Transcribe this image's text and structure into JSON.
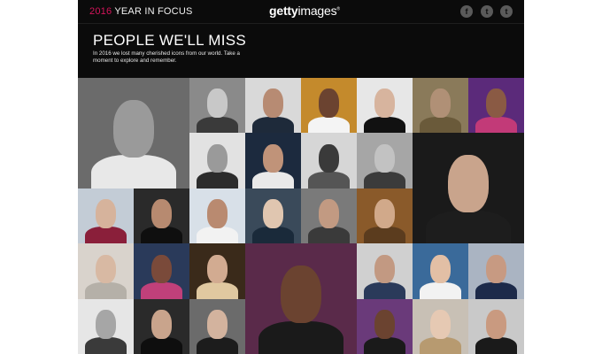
{
  "header": {
    "year": "2016",
    "title_rest": " YEAR IN FOCUS",
    "logo_bold": "getty",
    "logo_rest": "images",
    "logo_mark": "®"
  },
  "social": [
    {
      "name": "facebook-icon",
      "glyph": "f"
    },
    {
      "name": "twitter-icon",
      "glyph": "t"
    },
    {
      "name": "tumblr-icon",
      "glyph": "t"
    }
  ],
  "hero": {
    "title": "PEOPLE WE'LL MISS",
    "subtitle": "In 2016 we lost many cherished icons from our world. Take a moment to explore and remember."
  },
  "colors": {
    "accent": "#d4145a",
    "background": "#0b0b0b"
  },
  "tiles": [
    {
      "bg": "#6b6b6b",
      "skin": "#9a9a9a",
      "cloth": "#e8e8e8"
    },
    {
      "bg": "#8a8a8a",
      "skin": "#c8c8c8",
      "cloth": "#3a3a3a"
    },
    {
      "bg": "#d9d9d9",
      "skin": "#b78b73",
      "cloth": "#1e2a3a"
    },
    {
      "bg": "#c48a2c",
      "skin": "#6b4330",
      "cloth": "#f4f4f4"
    },
    {
      "bg": "#e7e7e7",
      "skin": "#d7b49e",
      "cloth": "#111111"
    },
    {
      "bg": "#8a7a5a",
      "skin": "#b09076",
      "cloth": "#6a5a3a"
    },
    {
      "bg": "#5b2a7a",
      "skin": "#8a5a44",
      "cloth": "#c23a78"
    },
    {
      "bg": "#e2e2e2",
      "skin": "#9a9a9a",
      "cloth": "#2c2c2c"
    },
    {
      "bg": "#1c2a3e",
      "skin": "#c09379",
      "cloth": "#e9e9e9"
    },
    {
      "bg": "#d6d6d6",
      "skin": "#3a3a3a",
      "cloth": "#555555"
    },
    {
      "bg": "#a6a6a6",
      "skin": "#c2c2c2",
      "cloth": "#3b3b3b"
    },
    {
      "bg": "#1a1a1a",
      "skin": "#c9a48c",
      "cloth": "#1d1d1d"
    },
    {
      "bg": "#c3ccd6",
      "skin": "#d6b39c",
      "cloth": "#8a1f3a"
    },
    {
      "bg": "#2a2a2a",
      "skin": "#b78a70",
      "cloth": "#0f0f0f"
    },
    {
      "bg": "#d8e0e8",
      "skin": "#b98a70",
      "cloth": "#f2f2f2"
    },
    {
      "bg": "#3a4a5a",
      "skin": "#e0c6b0",
      "cloth": "#1a2a3a"
    },
    {
      "bg": "#7a7a7a",
      "skin": "#c29a82",
      "cloth": "#3a3a3a"
    },
    {
      "bg": "#8a5a2a",
      "skin": "#d1a98a",
      "cloth": "#5b3c1e"
    },
    {
      "bg": "#d9d3cc",
      "skin": "#d8b9a3",
      "cloth": "#b5b0a8"
    },
    {
      "bg": "#2a3a5a",
      "skin": "#7a4a3a",
      "cloth": "#c0407a"
    },
    {
      "bg": "#3a2a1a",
      "skin": "#d2ab91",
      "cloth": "#e0c8a0"
    },
    {
      "bg": "#5a2a4a",
      "skin": "#6b4330",
      "cloth": "#1a1a1a"
    },
    {
      "bg": "#d0d0d0",
      "skin": "#c29982",
      "cloth": "#2a3a5a"
    },
    {
      "bg": "#3a6a9a",
      "skin": "#e2bfa5",
      "cloth": "#f2f2f2"
    },
    {
      "bg": "#aab4c2",
      "skin": "#c79a82",
      "cloth": "#1c2a4a"
    },
    {
      "bg": "#e6e6e6",
      "skin": "#a6a6a6",
      "cloth": "#3a3a3a"
    },
    {
      "bg": "#2a2a2a",
      "skin": "#c9a48c",
      "cloth": "#0e0e0e"
    },
    {
      "bg": "#6b6b6b",
      "skin": "#d3b39e",
      "cloth": "#1c1c1c"
    },
    {
      "bg": "#6a3a7a",
      "skin": "#6b4330",
      "cloth": "#1a1a1a"
    },
    {
      "bg": "#c8c0b5",
      "skin": "#e6c9b3",
      "cloth": "#b79a70"
    },
    {
      "bg": "#c9c9c9",
      "skin": "#c99a80",
      "cloth": "#1a1a1a"
    },
    {
      "bg": "#c68a2a",
      "skin": "#4a2e20",
      "cloth": "#151515"
    }
  ]
}
